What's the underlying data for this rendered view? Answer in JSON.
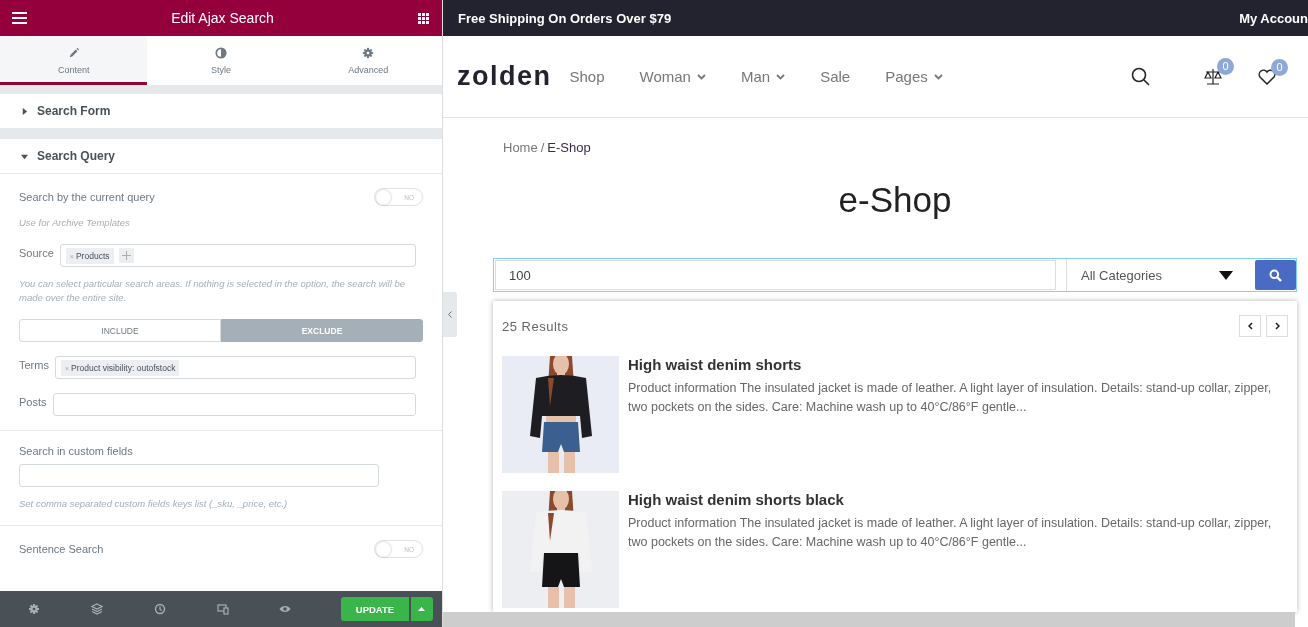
{
  "editor": {
    "title": "Edit Ajax Search",
    "tabs": [
      {
        "label": "Content",
        "selected": true
      },
      {
        "label": "Style",
        "selected": false
      },
      {
        "label": "Advanced",
        "selected": false
      }
    ],
    "sections": [
      {
        "title": "Search Form",
        "expanded": false
      },
      {
        "title": "Search Query",
        "expanded": true
      }
    ],
    "groups": [
      [
        {
          "kind": "switch",
          "label": "Search by the current query",
          "on": false,
          "switch_text": "NO",
          "note": "Use for Archive Templates"
        },
        {
          "kind": "tags",
          "label": "Source",
          "tags": [
            {
              "text": "Products",
              "remove": "×"
            }
          ],
          "addable": true,
          "note": "You can select particular search areas. If nothing is selected in the option, the search will be made over the entire site."
        },
        {
          "kind": "segmented",
          "options": [
            {
              "label": "INCLUDE",
              "selected": false
            },
            {
              "label": "EXCLUDE",
              "selected": true
            }
          ]
        },
        {
          "kind": "tags",
          "label": "Terms",
          "tags": [
            {
              "text": "Product visibility: outofstock",
              "remove": "×"
            }
          ],
          "addable": false
        },
        {
          "kind": "tags",
          "label": "Posts",
          "addable": false
        }
      ],
      [
        {
          "kind": "text",
          "label": "Search in custom fields",
          "note": "Set comma separated custom fields keys list (_sku, _price, etc.)"
        }
      ],
      [
        {
          "kind": "switch",
          "label": "Sentence Search",
          "on": false,
          "switch_text": "NO"
        }
      ]
    ],
    "footer": {
      "button": "UPDATE"
    }
  },
  "site": {
    "top_bar": {
      "promo": "Free Shipping On Orders Over $79",
      "account": "My Accoun"
    },
    "logo": "zolden",
    "nav": [
      {
        "label": "Shop",
        "dropdown": false
      },
      {
        "label": "Woman",
        "dropdown": true
      },
      {
        "label": "Man",
        "dropdown": true
      },
      {
        "label": "Sale",
        "dropdown": false
      },
      {
        "label": "Pages",
        "dropdown": true
      }
    ],
    "compare_count": "0",
    "wishlist_count": "0",
    "breadcrumb": [
      {
        "label": "Home",
        "separator": "/"
      },
      {
        "label": "E-Shop"
      }
    ],
    "page_title": "e-Shop",
    "search": {
      "value": "100",
      "category": "All Categories"
    },
    "results": {
      "count": "25 Results",
      "items": [
        {
          "title": "High waist denim shorts",
          "description": "Product information The insulated jacket is made of leather. A light layer of insulation. Details: stand-up collar, zipper, two pockets on the sides. Care: Machine wash up to 40°C/86°F gentle..."
        },
        {
          "title": "High waist denim shorts black",
          "description": "Product information The insulated jacket is made of leather. A light layer of insulation. Details: stand-up collar, zipper, two pockets on the sides. Care: Machine wash up to 40°C/86°F gentle..."
        }
      ]
    }
  }
}
